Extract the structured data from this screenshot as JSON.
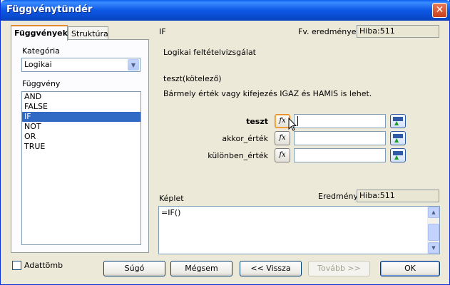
{
  "window": {
    "title": "Függvénytündér",
    "close_label": "✕"
  },
  "tabs": [
    {
      "label": "Függvények",
      "accesskey_label_rest": ""
    },
    {
      "label": "Struktúra"
    }
  ],
  "left": {
    "category_label": "Kategória",
    "category_value": "Logikai",
    "function_label": "Függvény",
    "functions": [
      "AND",
      "FALSE",
      "IF",
      "NOT",
      "OR",
      "TRUE"
    ],
    "selected_index": 2
  },
  "right": {
    "function_name": "IF",
    "result_label": "Fv. eredménye:",
    "result_value": "Hiba:511",
    "description": "Logikai feltételvizsgálat",
    "param_heading": "teszt(kötelező)",
    "param_description": "Bármely érték vagy kifejezés IGAZ és HAMIS is lehet.",
    "args": [
      {
        "label": "teszt",
        "value": ""
      },
      {
        "label": "akkor_érték",
        "value": ""
      },
      {
        "label": "különben_érték",
        "value": ""
      }
    ],
    "fx_label": "fx",
    "formula_label": "Képlet",
    "formula_value": "=IF()",
    "eredmeny_label": "Eredmény",
    "eredmeny_value": "Hiba:511"
  },
  "footer": {
    "array_label": "Adattömb",
    "array_checked": false,
    "help_label": "Súgó",
    "cancel_label": "Mégsem",
    "back_label": "<< Vissza",
    "next_label": "Tovább >>",
    "ok_label": "OK"
  }
}
